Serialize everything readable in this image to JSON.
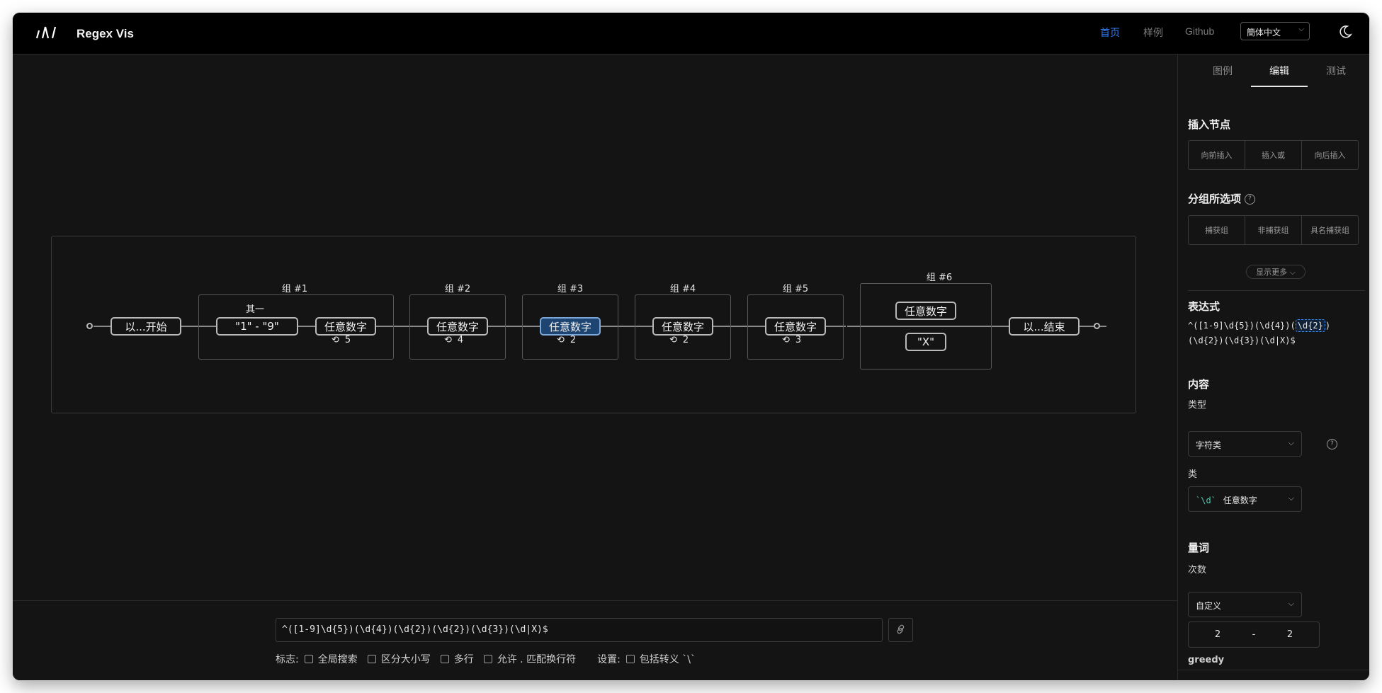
{
  "header": {
    "brand": "Regex Vis",
    "nav": [
      "首页",
      "样例",
      "Github"
    ],
    "language": "簡体中文"
  },
  "diagram": {
    "groups": [
      "组 #1",
      "组 #2",
      "组 #3",
      "组 #4",
      "组 #5",
      "组 #6"
    ],
    "nodes": {
      "start": "以...开始",
      "range": "\"1\" - \"9\"",
      "range_label": "其一",
      "digit": "任意数字",
      "x": "\"X\"",
      "end": "以...结束"
    },
    "repeats": [
      "5",
      "4",
      "2",
      "2",
      "3"
    ]
  },
  "bottom": {
    "regex": "^([1-9]\\d{5})(\\d{4})(\\d{2})(\\d{2})(\\d{3})(\\d|X)$",
    "flags_label": "标志:",
    "flags": [
      "全局搜索",
      "区分大小写",
      "多行",
      "允许 . 匹配换行符"
    ],
    "settings_label": "设置:",
    "settings": [
      "包括转义 `\\`"
    ]
  },
  "panel": {
    "tabs": [
      "图例",
      "编辑",
      "测试"
    ],
    "insert_title": "插入节点",
    "insert_buttons": [
      "向前插入",
      "插入或",
      "向后插入"
    ],
    "group_title": "分组所选项",
    "group_buttons": [
      "捕获组",
      "非捕获组",
      "具名捕获组"
    ],
    "show_more": "显示更多",
    "expression_title": "表达式",
    "expression": {
      "line1_pre": "^([1-9]\\d{5})(\\d{4})(",
      "line1_hl": "\\d{2}",
      "line1_post": ")",
      "line2": "(\\d{2})(\\d{3})(\\d|X)$"
    },
    "content_title": "内容",
    "type_label": "类型",
    "type_value": "字符类",
    "class_label": "类",
    "class_code": "`\\d`",
    "class_value": "任意数字",
    "quantifier_title": "量词",
    "times_label": "次数",
    "times_value": "自定义",
    "min": "2",
    "range_sep": "-",
    "max": "2",
    "greedy_label": "greedy",
    "collapse": "»"
  }
}
